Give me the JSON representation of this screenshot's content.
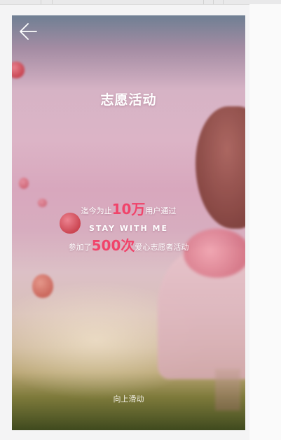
{
  "page": {
    "title": "志愿活动",
    "back_icon": "arrow-left-icon",
    "stats": {
      "line1_prefix": "迄今为止",
      "line1_value": "10万",
      "line1_suffix": "用户通过",
      "line2": "STAY WITH ME",
      "line3_prefix": "参加了",
      "line3_value": "500次",
      "line3_suffix": "爱心志愿者活动"
    },
    "swipe_hint": "向上滑动",
    "colors": {
      "accent": "#f0446a",
      "text": "#ffffff"
    }
  }
}
